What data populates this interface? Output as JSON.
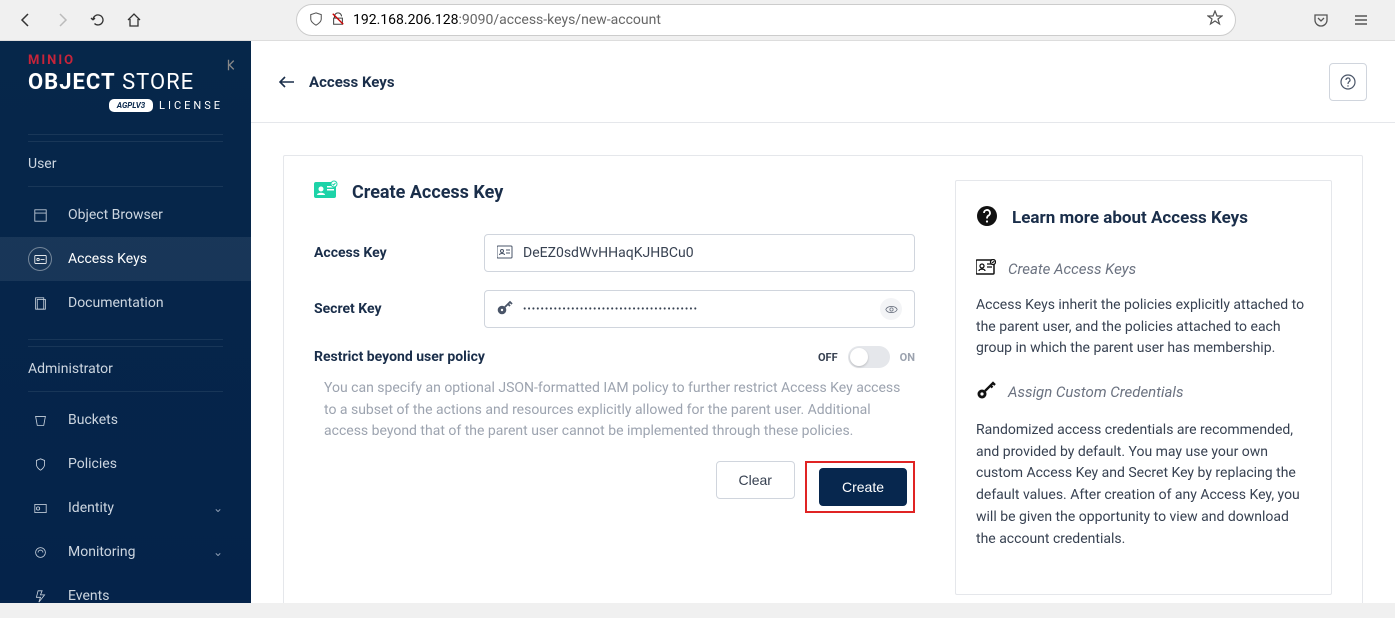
{
  "browser": {
    "url_host": "192.168.206.128",
    "url_path": ":9090/access-keys/new-account"
  },
  "logo": {
    "brand": "MINIO",
    "title_bold": "OBJECT",
    "title_rest": "STORE",
    "license_badge": "AGPLV3",
    "license": "LICENSE"
  },
  "sidebar": {
    "sections": [
      {
        "label": "User",
        "items": [
          {
            "label": "Object Browser"
          },
          {
            "label": "Access Keys"
          },
          {
            "label": "Documentation"
          }
        ]
      },
      {
        "label": "Administrator",
        "items": [
          {
            "label": "Buckets"
          },
          {
            "label": "Policies"
          },
          {
            "label": "Identity"
          },
          {
            "label": "Monitoring"
          },
          {
            "label": "Events"
          }
        ]
      }
    ]
  },
  "topbar": {
    "back_label": "Access Keys"
  },
  "form": {
    "title": "Create Access Key",
    "access_key_label": "Access Key",
    "access_key_value": "DeEZ0sdWvHHaqKJHBCu0",
    "secret_key_label": "Secret Key",
    "secret_key_mask": "●●●●●●●●●●●●●●●●●●●●●●●●●●●●●●●●●●●●●●●●",
    "restrict_label": "Restrict beyond user policy",
    "toggle_off": "OFF",
    "toggle_on": "ON",
    "restrict_help": "You can specify an optional JSON-formatted IAM policy to further restrict Access Key access to a subset of the actions and resources explicitly allowed for the parent user. Additional access beyond that of the parent user cannot be implemented through these policies.",
    "btn_clear": "Clear",
    "btn_create": "Create"
  },
  "info": {
    "title": "Learn more about Access Keys",
    "sub1": "Create Access Keys",
    "p1": "Access Keys inherit the policies explicitly attached to the parent user, and the policies attached to each group in which the parent user has membership.",
    "sub2": "Assign Custom Credentials",
    "p2": "Randomized access credentials are recommended, and provided by default. You may use your own custom Access Key and Secret Key by replacing the default values. After creation of any Access Key, you will be given the opportunity to view and download the account credentials."
  }
}
